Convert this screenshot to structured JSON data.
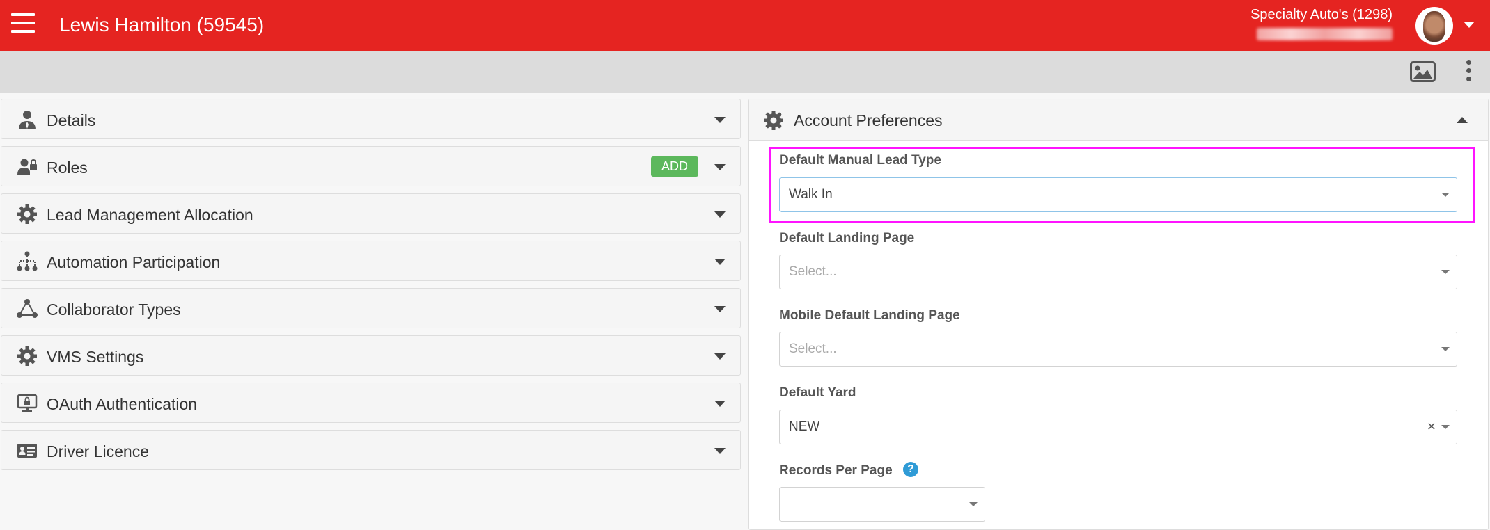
{
  "header": {
    "title": "Lewis Hamilton (59545)",
    "company": "Specialty Auto's (1298)"
  },
  "left_panels": [
    {
      "label": "Details",
      "icon": "user-tie-icon"
    },
    {
      "label": "Roles",
      "icon": "user-lock-icon",
      "action": "ADD"
    },
    {
      "label": "Lead Management Allocation",
      "icon": "gear-icon"
    },
    {
      "label": "Automation Participation",
      "icon": "sitemap-icon"
    },
    {
      "label": "Collaborator Types",
      "icon": "collab-triangle-icon"
    },
    {
      "label": "VMS Settings",
      "icon": "gear-icon"
    },
    {
      "label": "OAuth Authentication",
      "icon": "monitor-lock-icon"
    },
    {
      "label": "Driver Licence",
      "icon": "id-card-icon"
    }
  ],
  "account_preferences": {
    "title": "Account Preferences",
    "fields": [
      {
        "label": "Default Manual Lead Type",
        "value": "Walk In",
        "placeholder": ""
      },
      {
        "label": "Default Landing Page",
        "value": "",
        "placeholder": "Select..."
      },
      {
        "label": "Mobile Default Landing Page",
        "value": "",
        "placeholder": "Select..."
      },
      {
        "label": "Default Yard",
        "value": "NEW",
        "placeholder": ""
      },
      {
        "label": "Records Per Page",
        "value": "",
        "placeholder": ""
      }
    ],
    "help_glyph": "?",
    "clear_glyph": "×"
  },
  "colors": {
    "brand": "#e52421",
    "success": "#5cb85c",
    "highlight": "#ff14ff",
    "info": "#2f9bd6"
  }
}
